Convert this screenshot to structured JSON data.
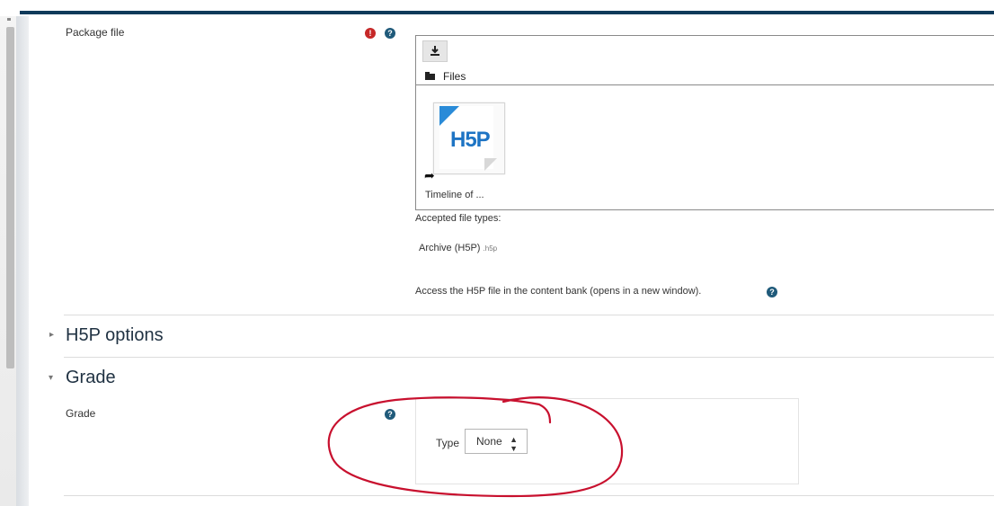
{
  "package": {
    "label": "Package file",
    "folder_label": "Files",
    "file_name": "Timeline of ...",
    "thumb_text": "H5P",
    "accepted_label": "Accepted file types:",
    "archive_label": "Archive (H5P)",
    "archive_ext": ".h5p",
    "content_bank_text": "Access the H5P file in the content bank (opens in a new window)."
  },
  "sections": {
    "h5p_options": "H5P options",
    "grade": "Grade"
  },
  "grade": {
    "label": "Grade",
    "type_label": "Type",
    "type_value": "None"
  },
  "icons": {
    "required": "required-icon",
    "help": "help-icon",
    "download": "download-icon",
    "folder": "folder-icon",
    "share": "share-icon",
    "caret_right": "caret-right-icon",
    "caret_down": "caret-down-icon"
  },
  "colors": {
    "topbar": "#0f3a5a",
    "required": "#c62828",
    "help": "#1f5a7a",
    "h5p_blue": "#1e74c4",
    "annotation": "#c8102e"
  }
}
